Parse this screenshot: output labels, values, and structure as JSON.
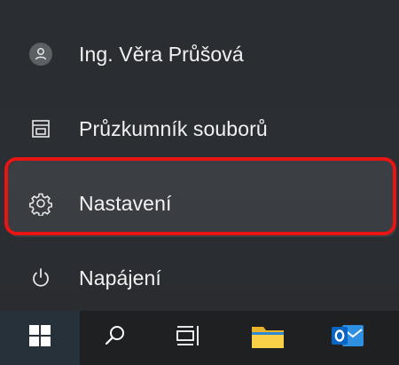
{
  "start_menu": {
    "items": [
      {
        "label": "Ing. Věra Průšová",
        "icon": "user-avatar-icon"
      },
      {
        "label": "Průzkumník souborů",
        "icon": "file-explorer-icon"
      },
      {
        "label": "Nastavení",
        "icon": "gear-icon"
      },
      {
        "label": "Napájení",
        "icon": "power-icon"
      }
    ],
    "highlighted_item": "Nastavení",
    "highlight_color": "#e81515"
  },
  "taskbar": {
    "buttons": [
      {
        "icon": "windows-start-icon"
      },
      {
        "icon": "search-icon"
      },
      {
        "icon": "task-view-icon"
      },
      {
        "icon": "folder-icon"
      },
      {
        "icon": "outlook-icon"
      }
    ]
  }
}
